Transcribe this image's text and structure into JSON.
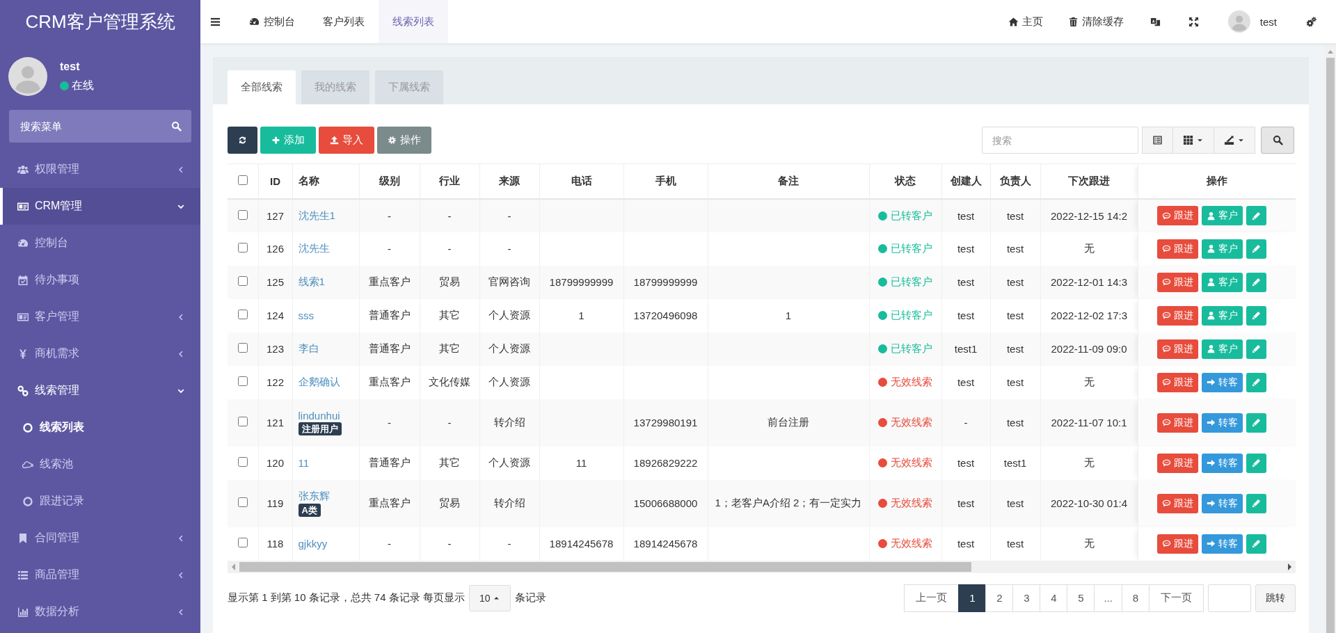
{
  "sidebar": {
    "title": "CRM客户管理系统",
    "user": {
      "name": "test",
      "status": "在线",
      "online": true
    },
    "search": {
      "placeholder": "搜索菜单"
    },
    "items": [
      {
        "kind": "users",
        "label": "权限管理",
        "expanded": false,
        "selected": false
      },
      {
        "kind": "idcard",
        "label": "CRM管理",
        "expanded": true,
        "selected": true,
        "children": [
          {
            "kind": "dashboard",
            "label": "控制台",
            "selected": false
          },
          {
            "kind": "calendar",
            "label": "待办事项",
            "selected": false
          },
          {
            "kind": "idcard",
            "label": "客户管理",
            "expanded": false,
            "selected": false
          },
          {
            "kind": "yen",
            "label": "商机需求",
            "expanded": false,
            "selected": false
          },
          {
            "kind": "link",
            "label": "线索管理",
            "expanded": true,
            "selected": true,
            "children": [
              {
                "kind": "ring",
                "label": "线索列表",
                "selected": true
              },
              {
                "kind": "cloud",
                "label": "线索池",
                "selected": false
              },
              {
                "kind": "ring",
                "label": "跟进记录",
                "selected": false
              }
            ]
          }
        ]
      },
      {
        "kind": "bookmark",
        "label": "合同管理",
        "expanded": false,
        "selected": false
      },
      {
        "kind": "list",
        "label": "商品管理",
        "expanded": false,
        "selected": false
      },
      {
        "kind": "chart",
        "label": "数据分析",
        "expanded": false,
        "selected": false
      }
    ]
  },
  "topbar": {
    "tabs": [
      {
        "kind": "dashboard",
        "label": "控制台",
        "selected": false
      },
      {
        "kind": "plain",
        "label": "客户列表",
        "selected": false
      },
      {
        "kind": "plain",
        "label": "线索列表",
        "selected": true
      }
    ],
    "tools": [
      {
        "kind": "home",
        "label": "主页"
      },
      {
        "kind": "trash",
        "label": "清除缓存"
      },
      {
        "kind": "translate"
      },
      {
        "kind": "fullscreen"
      },
      {
        "kind": "user",
        "label": "test"
      },
      {
        "kind": "settings"
      }
    ]
  },
  "panel": {
    "tabs": [
      {
        "label": "全部线索",
        "selected": true
      },
      {
        "label": "我的线索",
        "selected": false
      },
      {
        "label": "下属线索",
        "selected": false
      }
    ],
    "toolbar": {
      "buttons": [
        {
          "kind": "refresh"
        },
        {
          "kind": "add",
          "label": "添加"
        },
        {
          "kind": "import",
          "label": "导入"
        },
        {
          "kind": "operate",
          "label": "操作"
        }
      ],
      "search": {
        "placeholder": "搜索"
      },
      "view_buttons": [
        {
          "kind": "table"
        },
        {
          "kind": "columns"
        },
        {
          "kind": "export"
        },
        {
          "kind": "search"
        }
      ]
    }
  },
  "table": {
    "header_checked": false,
    "columns": [
      "ID",
      "名称",
      "级别",
      "行业",
      "来源",
      "电话",
      "手机",
      "备注",
      "状态",
      "创建人",
      "负责人",
      "下次跟进",
      "操作"
    ],
    "rows": [
      {
        "checked": false,
        "id": "127",
        "name": "沈先生1",
        "level": "-",
        "industry": "-",
        "source": "-",
        "status": {
          "label": "已转客户",
          "color": "#18bc9c"
        },
        "creator": "test",
        "owner": "test",
        "next_followup": "2022-12-15 14:2",
        "actions": [
          {
            "kind": "follow",
            "label": "跟进"
          },
          {
            "kind": "customer",
            "label": "客户"
          },
          {
            "kind": "edit"
          }
        ]
      },
      {
        "checked": false,
        "id": "126",
        "name": "沈先生",
        "level": "-",
        "industry": "-",
        "source": "-",
        "status": {
          "label": "已转客户",
          "color": "#18bc9c"
        },
        "creator": "test",
        "owner": "test",
        "next_followup": "无",
        "actions": [
          {
            "kind": "follow",
            "label": "跟进"
          },
          {
            "kind": "customer",
            "label": "客户"
          },
          {
            "kind": "edit"
          }
        ]
      },
      {
        "checked": false,
        "id": "125",
        "name": "线索1",
        "level": "重点客户",
        "industry": "贸易",
        "source": "官网咨询",
        "phone": "18799999999",
        "mobile": "18799999999",
        "status": {
          "label": "已转客户",
          "color": "#18bc9c"
        },
        "creator": "test",
        "owner": "test",
        "next_followup": "2022-12-01 14:3",
        "actions": [
          {
            "kind": "follow",
            "label": "跟进"
          },
          {
            "kind": "customer",
            "label": "客户"
          },
          {
            "kind": "edit"
          }
        ]
      },
      {
        "checked": false,
        "id": "124",
        "name": "sss",
        "level": "普通客户",
        "industry": "其它",
        "source": "个人资源",
        "phone": "1",
        "mobile": "13720496098",
        "note": "1",
        "status": {
          "label": "已转客户",
          "color": "#18bc9c"
        },
        "creator": "test",
        "owner": "test",
        "next_followup": "2022-12-02 17:3",
        "actions": [
          {
            "kind": "follow",
            "label": "跟进"
          },
          {
            "kind": "customer",
            "label": "客户"
          },
          {
            "kind": "edit"
          }
        ]
      },
      {
        "checked": false,
        "id": "123",
        "name": "李白",
        "level": "普通客户",
        "industry": "其它",
        "source": "个人资源",
        "status": {
          "label": "已转客户",
          "color": "#18bc9c"
        },
        "creator": "test1",
        "owner": "test",
        "next_followup": "2022-11-09 09:0",
        "actions": [
          {
            "kind": "follow",
            "label": "跟进"
          },
          {
            "kind": "customer",
            "label": "客户"
          },
          {
            "kind": "edit"
          }
        ]
      },
      {
        "checked": false,
        "id": "122",
        "name": "企鹅确认",
        "level": "重点客户",
        "industry": "文化传媒",
        "source": "个人资源",
        "status": {
          "label": "无效线索",
          "color": "#e74c3c"
        },
        "creator": "test",
        "owner": "test",
        "next_followup": "无",
        "actions": [
          {
            "kind": "follow",
            "label": "跟进"
          },
          {
            "kind": "convert",
            "label": "转客"
          },
          {
            "kind": "edit"
          }
        ]
      },
      {
        "checked": false,
        "id": "121",
        "name": "lindunhui",
        "tag": "注册用户",
        "level": "-",
        "industry": "-",
        "source": "转介绍",
        "mobile": "13729980191",
        "note": "前台注册",
        "status": {
          "label": "无效线索",
          "color": "#e74c3c"
        },
        "creator": "-",
        "owner": "test",
        "next_followup": "2022-11-07 10:1",
        "actions": [
          {
            "kind": "follow",
            "label": "跟进"
          },
          {
            "kind": "convert",
            "label": "转客"
          },
          {
            "kind": "edit"
          }
        ]
      },
      {
        "checked": false,
        "id": "120",
        "name": "11",
        "level": "普通客户",
        "industry": "其它",
        "source": "个人资源",
        "phone": "11",
        "mobile": "18926829222",
        "status": {
          "label": "无效线索",
          "color": "#e74c3c"
        },
        "creator": "test",
        "owner": "test1",
        "next_followup": "无",
        "actions": [
          {
            "kind": "follow",
            "label": "跟进"
          },
          {
            "kind": "convert",
            "label": "转客"
          },
          {
            "kind": "edit"
          }
        ]
      },
      {
        "checked": false,
        "id": "119",
        "name": "张东辉",
        "tag": "A类",
        "level": "重点客户",
        "industry": "贸易",
        "source": "转介绍",
        "mobile": "15006688000",
        "note": "1；老客户A介绍 2；有一定实力",
        "status": {
          "label": "无效线索",
          "color": "#e74c3c"
        },
        "creator": "test",
        "owner": "test",
        "next_followup": "2022-10-30 01:4",
        "actions": [
          {
            "kind": "follow",
            "label": "跟进"
          },
          {
            "kind": "convert",
            "label": "转客"
          },
          {
            "kind": "edit"
          }
        ]
      },
      {
        "checked": false,
        "id": "118",
        "name": "gjkkyy",
        "level": "-",
        "industry": "-",
        "source": "-",
        "phone": "18914245678",
        "mobile": "18914245678",
        "status": {
          "label": "无效线索",
          "color": "#e74c3c"
        },
        "creator": "test",
        "owner": "test",
        "next_followup": "无",
        "actions": [
          {
            "kind": "follow",
            "label": "跟进"
          },
          {
            "kind": "convert",
            "label": "转客"
          },
          {
            "kind": "edit"
          }
        ]
      }
    ]
  },
  "footer": {
    "summary": "显示第 1 到第 10 条记录，总共 74 条记录 每页显示",
    "page_size": "10",
    "page_size_suffix": "条记录",
    "pages": [
      {
        "label": "上一页",
        "selected": false
      },
      {
        "label": "1",
        "selected": true
      },
      {
        "label": "2",
        "selected": false
      },
      {
        "label": "3",
        "selected": false
      },
      {
        "label": "4",
        "selected": false
      },
      {
        "label": "5",
        "selected": false
      },
      {
        "label": "...",
        "selected": false
      },
      {
        "label": "8",
        "selected": false
      },
      {
        "label": "下一页",
        "selected": false
      }
    ],
    "jump_button": "跳转"
  }
}
